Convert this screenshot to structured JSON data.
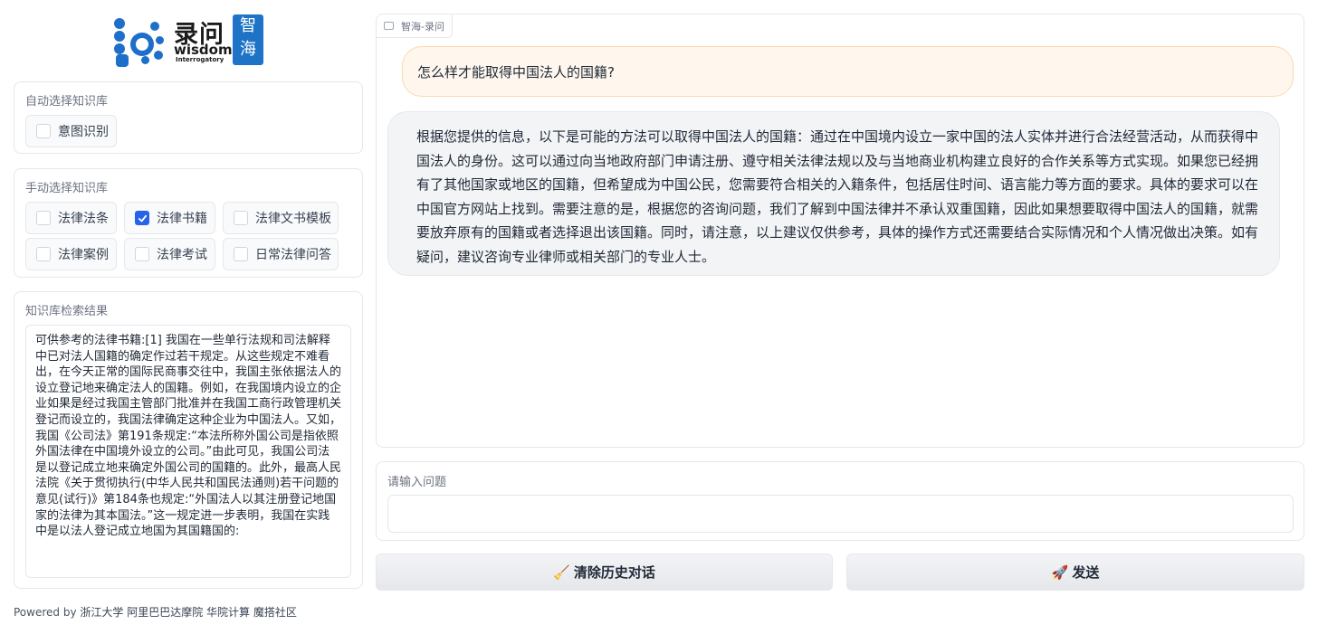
{
  "logo": {
    "text_cn": "录问",
    "text_en": "wisdom",
    "text_sub": "Interrogatory",
    "seal_text": "智海"
  },
  "auto_kb": {
    "label": "自动选择知识库",
    "options": [
      {
        "label": "意图识别",
        "checked": false
      }
    ]
  },
  "manual_kb": {
    "label": "手动选择知识库",
    "options": [
      {
        "label": "法律法条",
        "checked": false
      },
      {
        "label": "法律书籍",
        "checked": true
      },
      {
        "label": "法律文书模板",
        "checked": false
      },
      {
        "label": "法律案例",
        "checked": false
      },
      {
        "label": "法律考试",
        "checked": false
      },
      {
        "label": "日常法律问答",
        "checked": false
      }
    ]
  },
  "kb_results": {
    "label": "知识库检索结果",
    "text": "可供参考的法律书籍:[1] 我国在一些单行法规和司法解释中已对法人国籍的确定作过若干规定。从这些规定不难看出，在今天正常的国际民商事交往中，我国主张依据法人的设立登记地来确定法人的国籍。例如，在我国境内设立的企业如果是经过我国主管部门批准并在我国工商行政管理机关登记而设立的，我国法律确定这种企业为中国法人。又如，我国《公司法》第191条规定:“本法所称外国公司是指依照外国法律在中国境外设立的公司。”由此可见，我国公司法是以登记成立地来确定外国公司的国籍的。此外，最高人民法院《关于贯彻执行(中华人民共和国民法通则)若干问题的意见(试行)》第184条也规定:“外国法人以其注册登记地国家的法律为其本国法。”这一规定进一步表明，我国在实践中是以法人登记成立地国为其国籍国的:"
  },
  "footer": {
    "prefix": "Powered by",
    "links": "浙江大学 阿里巴巴达摩院 华院计算 魔搭社区"
  },
  "chat": {
    "tab_label": "智海-录问",
    "user_message": "怎么样才能取得中国法人的国籍?",
    "bot_message": "根据您提供的信息，以下是可能的方法可以取得中国法人的国籍：通过在中国境内设立一家中国的法人实体并进行合法经营活动，从而获得中国法人的身份。这可以通过向当地政府部门申请注册、遵守相关法律法规以及与当地商业机构建立良好的合作关系等方式实现。如果您已经拥有了其他国家或地区的国籍，但希望成为中国公民，您需要符合相关的入籍条件，包括居住时间、语言能力等方面的要求。具体的要求可以在中国官方网站上找到。需要注意的是，根据您的咨询问题，我们了解到中国法律并不承认双重国籍，因此如果想要取得中国法人的国籍，就需要放弃原有的国籍或者选择退出该国籍。同时，请注意，以上建议仅供参考，具体的操作方式还需要结合实际情况和个人情况做出决策。如有疑问，建议咨询专业律师或相关部门的专业人士。"
  },
  "input": {
    "label": "请输入问题",
    "value": "",
    "placeholder": ""
  },
  "buttons": {
    "clear_icon": "🧹",
    "clear_label": "清除历史对话",
    "send_icon": "🚀",
    "send_label": "发送"
  },
  "colors": {
    "accent": "#2563eb",
    "user_bubble_bg": "#fff7ed",
    "user_bubble_border": "#fed7aa",
    "bot_bubble_bg": "#f3f4f6",
    "logo_blue": "#1d6fc9"
  }
}
